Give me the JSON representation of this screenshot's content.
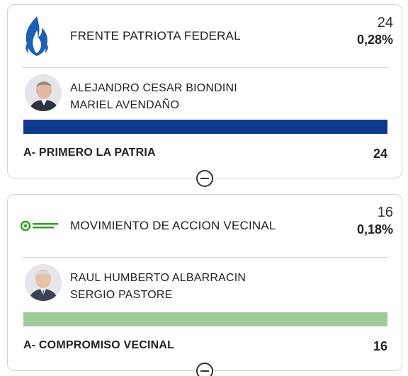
{
  "colors": {
    "card_border": "#cfd3d8",
    "fpf_bar": "#0d3a8c",
    "mav_bar": "#9fcb98",
    "mav_logo_green": "#3a9a2c",
    "fpf_logo_blue": "#1f5fb4"
  },
  "parties": [
    {
      "logo_icon": "flame-logo-icon",
      "name": "FRENTE PATRIOTA FEDERAL",
      "votes": "24",
      "percentage": "0,28%",
      "candidates": [
        "ALEJANDRO CESAR BIONDINI",
        "MARIEL AVENDAÑO"
      ],
      "bar_fraction": 1.0,
      "list": {
        "name": "A- PRIMERO LA PATRIA",
        "votes": "24"
      }
    },
    {
      "logo_icon": "movimiento-accion-vecinal-logo-icon",
      "logo_text": "Movimiento de Acción Vecinal",
      "name": "MOVIMIENTO DE ACCION VECINAL",
      "votes": "16",
      "percentage": "0,18%",
      "candidates": [
        "RAUL HUMBERTO ALBARRACIN",
        "SERGIO PASTORE"
      ],
      "bar_fraction": 1.0,
      "list": {
        "name": "A- COMPROMISO VECINAL",
        "votes": "16"
      }
    }
  ]
}
